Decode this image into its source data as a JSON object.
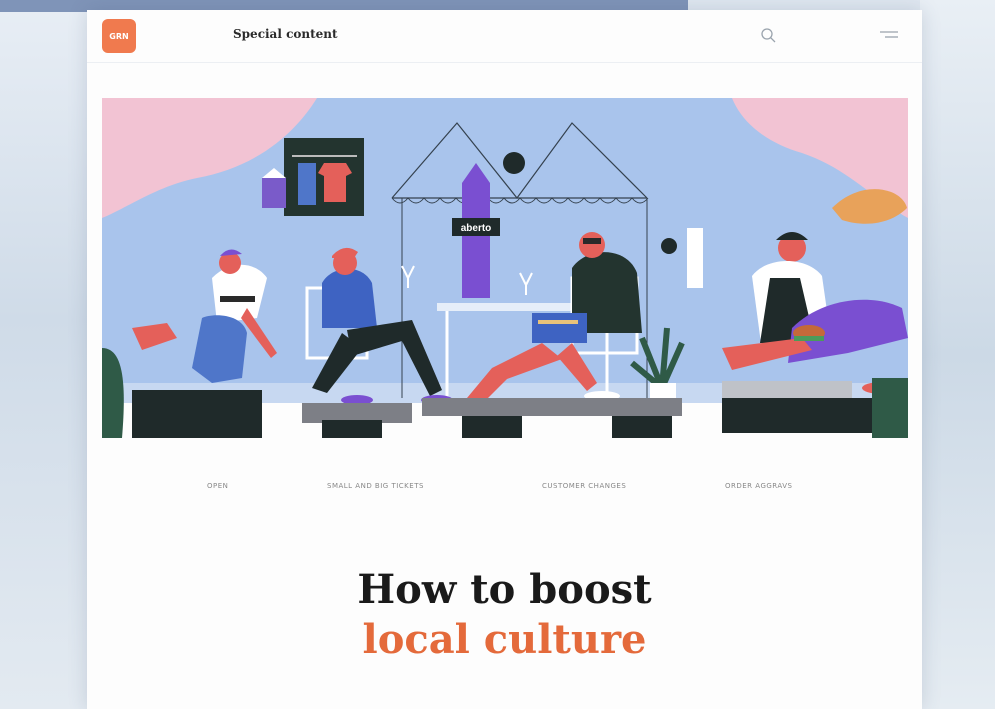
{
  "header": {
    "logo_text": "GRN",
    "title": "Special content",
    "search_icon": "search-icon",
    "menu_icon": "menu-icon"
  },
  "hero": {
    "sign_text": "aberto"
  },
  "nav": {
    "items": [
      {
        "label": "OPEN"
      },
      {
        "label": "SMALL AND BIG TICKETS"
      },
      {
        "label": "CUSTOMER CHANGES"
      },
      {
        "label": "ORDER AGGRAVS"
      }
    ]
  },
  "headline": {
    "line1": "How to boost",
    "line2": "local culture"
  },
  "colors": {
    "accent": "#e46a3b",
    "logo": "#f07a4e",
    "sky": "#a9c4ec",
    "pink": "#f2c3d3"
  }
}
